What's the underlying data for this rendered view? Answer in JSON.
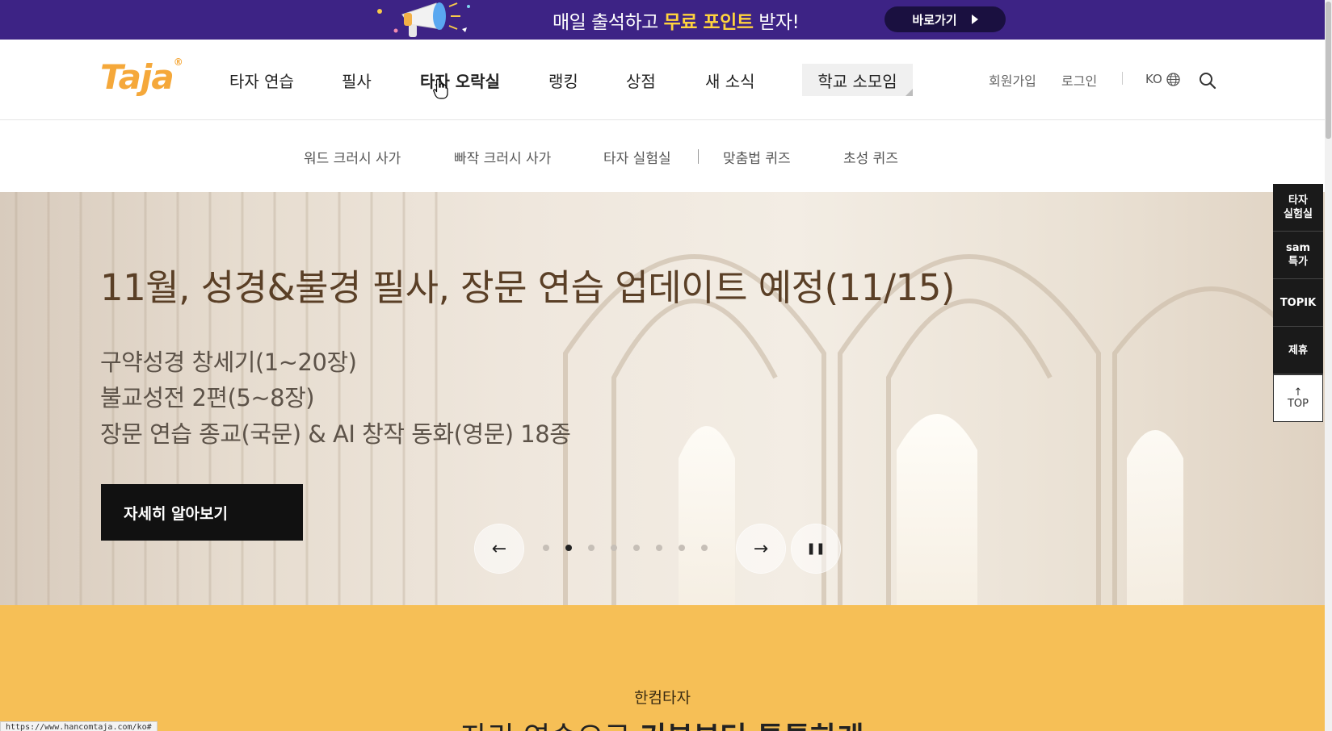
{
  "promo": {
    "text_prefix": "매일 출석하고 ",
    "text_highlight": "무료 포인트",
    "text_suffix": " 받자!",
    "button_label": "바로가기"
  },
  "header": {
    "logo_text": "Taja",
    "logo_mark": "®",
    "nav": [
      "타자 연습",
      "필사",
      "타자 오락실",
      "랭킹",
      "상점",
      "새 소식"
    ],
    "nav_active_index": 2,
    "nav_box": "학교 소모임",
    "signup": "회원가입",
    "login": "로그인",
    "lang": "KO"
  },
  "subnav": [
    "워드 크러시 사가",
    "빠작 크러시 사가",
    "타자 실험실",
    "맞춤법 퀴즈",
    "초성 퀴즈"
  ],
  "hero": {
    "title": "11월, 성경&불경 필사, 장문 연습 업데이트 예정(11/15)",
    "lines": [
      "구약성경 창세기(1~20장)",
      "불교성전 2편(5~8장)",
      "장문 연습 종교(국문) & AI 창작 동화(영문) 18종"
    ],
    "button": "자세히 알아보기",
    "slide_count": 8,
    "active_slide": 2
  },
  "band": {
    "kicker": "한컴타자",
    "heading_light": "자리 연습으로 ",
    "heading_bold": "기본부터 튼튼하게"
  },
  "quick_menu": [
    "타자\n실험실",
    "sam\n특가",
    "TOPIK",
    "제휴"
  ],
  "top_label": "TOP",
  "status_url": "https://www.hancomtaja.com/ko#"
}
